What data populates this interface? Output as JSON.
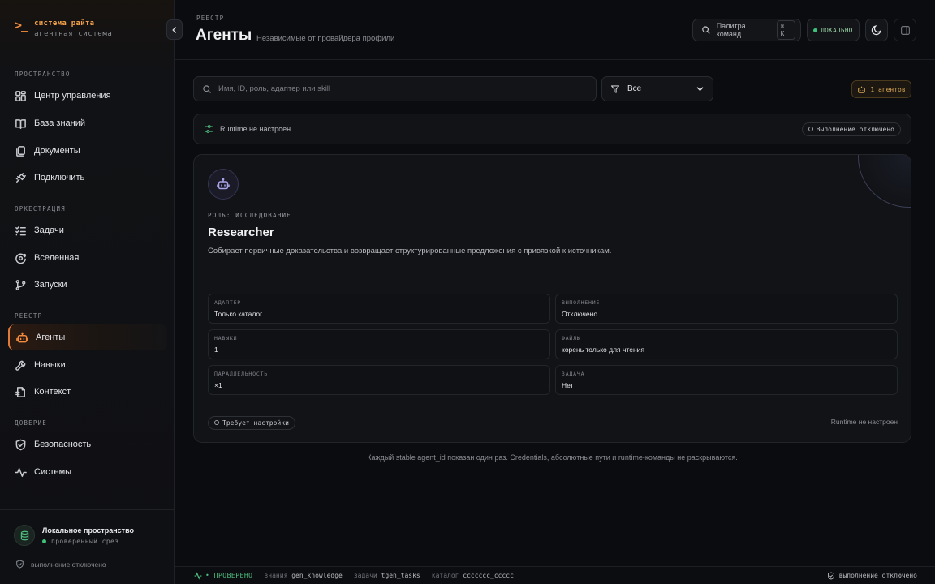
{
  "brand": {
    "glyph": ">_",
    "title": "система райта",
    "subtitle": "агентная система"
  },
  "sidebar": {
    "sections": [
      {
        "label": "ПРОСТРАНСТВО",
        "items": [
          {
            "label": "Центр управления",
            "icon": "dashboard-icon"
          },
          {
            "label": "База знаний",
            "icon": "book-icon"
          },
          {
            "label": "Документы",
            "icon": "documents-icon"
          },
          {
            "label": "Подключить",
            "icon": "plug-icon"
          }
        ]
      },
      {
        "label": "ОРКЕСТРАЦИЯ",
        "items": [
          {
            "label": "Задачи",
            "icon": "checklist-icon"
          },
          {
            "label": "Вселенная",
            "icon": "orbit-icon"
          },
          {
            "label": "Запуски",
            "icon": "git-branch-icon"
          }
        ]
      },
      {
        "label": "РЕЕСТР",
        "items": [
          {
            "label": "Агенты",
            "icon": "bot-icon",
            "active": true
          },
          {
            "label": "Навыки",
            "icon": "wrench-icon"
          },
          {
            "label": "Контекст",
            "icon": "file-context-icon"
          }
        ]
      },
      {
        "label": "ДОВЕРИЕ",
        "items": [
          {
            "label": "Безопасность",
            "icon": "shield-check-icon"
          },
          {
            "label": "Системы",
            "icon": "activity-icon"
          }
        ]
      }
    ],
    "workspace": {
      "name": "Локальное пространство",
      "status": "проверенный срез"
    },
    "execution_note": "выполнение отключено"
  },
  "header": {
    "kicker": "РЕЕСТР",
    "title": "Агенты",
    "subtitle": "Независимые от провайдера профили",
    "palette_label": "Палитра команд",
    "palette_shortcut": "⌘ K",
    "local_badge": "ЛОКАЛЬНО"
  },
  "toolbar": {
    "search_placeholder": "Имя, ID, роль, адаптер или skill",
    "filter_value": "Все",
    "agent_count": "1 агентов"
  },
  "runtime_banner": {
    "text": "Runtime не настроен",
    "status_pill": "Выполнение отключено"
  },
  "agent": {
    "role": "РОЛЬ: ИССЛЕДОВАНИЕ",
    "name": "Researcher",
    "description": "Собирает первичные доказательства и возвращает структурированные предложения с привязкой к источникам.",
    "fields": [
      {
        "label": "АДАПТЕР",
        "value": "Только каталог"
      },
      {
        "label": "ВЫПОЛНЕНИЕ",
        "value": "Отключено"
      },
      {
        "label": "НАВЫКИ",
        "value": "1"
      },
      {
        "label": "ФАЙЛЫ",
        "value": "корень только для чтения"
      },
      {
        "label": "ПАРАЛЛЕЛЬНОСТЬ",
        "value": "×1"
      },
      {
        "label": "ЗАДАЧА",
        "value": "Нет"
      }
    ],
    "footer_pill": "Требует настройки",
    "footer_right": "Runtime не настроен"
  },
  "note": "Каждый stable agent_id показан один раз. Credentials, абсолютные пути и runtime-команды не раскрываются.",
  "statusbar": {
    "verified": "• ПРОВЕРЕНО",
    "knowledge_key": "знания",
    "knowledge_val": "gen_knowledge",
    "tasks_key": "задачи",
    "tasks_val": "tgen_tasks",
    "catalog_key": "каталог",
    "catalog_val": "ccccccc_ccccc",
    "right": "выполнение отключено"
  },
  "colors": {
    "accent": "#f08a3c",
    "ok": "#4fbf80",
    "background": "#0b0c0f"
  }
}
